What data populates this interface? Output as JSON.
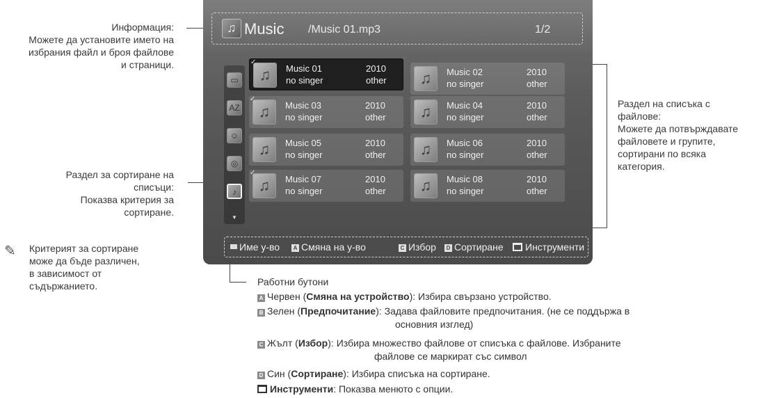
{
  "annotations": {
    "info": [
      "Информация:",
      "Можете да установите името на",
      "избрания файл и броя файлове",
      "и страници."
    ],
    "sort": [
      "Раздел за сортиране на",
      "списъци:",
      "Показва критерия за",
      "сортиране."
    ],
    "note": [
      "Критерият за сортиране",
      "може да бъде различен,",
      "в зависимост от",
      "съдържанието."
    ],
    "list": [
      "Раздел на списъка с",
      "файлове:",
      "Можете да потвърждавате",
      "файловете и групите,",
      "сортирани по всяка",
      "категория."
    ]
  },
  "screen": {
    "title": "Music",
    "file": "/Music 01.mp3",
    "page": "1/2",
    "items": [
      {
        "title": "Music 01",
        "singer": "no singer",
        "year": "2010",
        "genre": "other"
      },
      {
        "title": "Music 02",
        "singer": "no singer",
        "year": "2010",
        "genre": "other"
      },
      {
        "title": "Music 03",
        "singer": "no singer",
        "year": "2010",
        "genre": "other"
      },
      {
        "title": "Music 04",
        "singer": "no singer",
        "year": "2010",
        "genre": "other"
      },
      {
        "title": "Music 05",
        "singer": "no singer",
        "year": "2010",
        "genre": "other"
      },
      {
        "title": "Music 06",
        "singer": "no singer",
        "year": "2010",
        "genre": "other"
      },
      {
        "title": "Music 07",
        "singer": "no singer",
        "year": "2010",
        "genre": "other"
      },
      {
        "title": "Music 08",
        "singer": "no singer",
        "year": "2010",
        "genre": "other"
      }
    ],
    "buttons": {
      "device_name": "Име у-во",
      "change_device_key": "A",
      "change_device": "Смяна на у-во",
      "select_key": "C",
      "select": "Избор",
      "sort_key": "D",
      "sort": "Сортиране",
      "tools": "Инструменти"
    }
  },
  "legend": {
    "heading": "Работни бутони",
    "a": {
      "key": "A",
      "pre": "Червен (",
      "bold": "Смяна на устройство",
      "post": "): Избира свързано устройство."
    },
    "b": {
      "key": "B",
      "pre": "Зелен (",
      "bold": "Предпочитание",
      "post": "): Задава файловите предпочитания. (не се поддържа в",
      "cont": "основния изглед)"
    },
    "c": {
      "key": "C",
      "pre": "Жълт (",
      "bold": "Избор",
      "post": "): Избира множество файлове от списъка с файлове. Избраните",
      "cont": "файлове се маркират със символ"
    },
    "d": {
      "key": "D",
      "pre": "Син (",
      "bold": "Сортиране",
      "post": "): Избира списъка на сортиране."
    },
    "tools": {
      "bold": "Инструменти",
      "post": ": Показва менюто с опции."
    }
  }
}
